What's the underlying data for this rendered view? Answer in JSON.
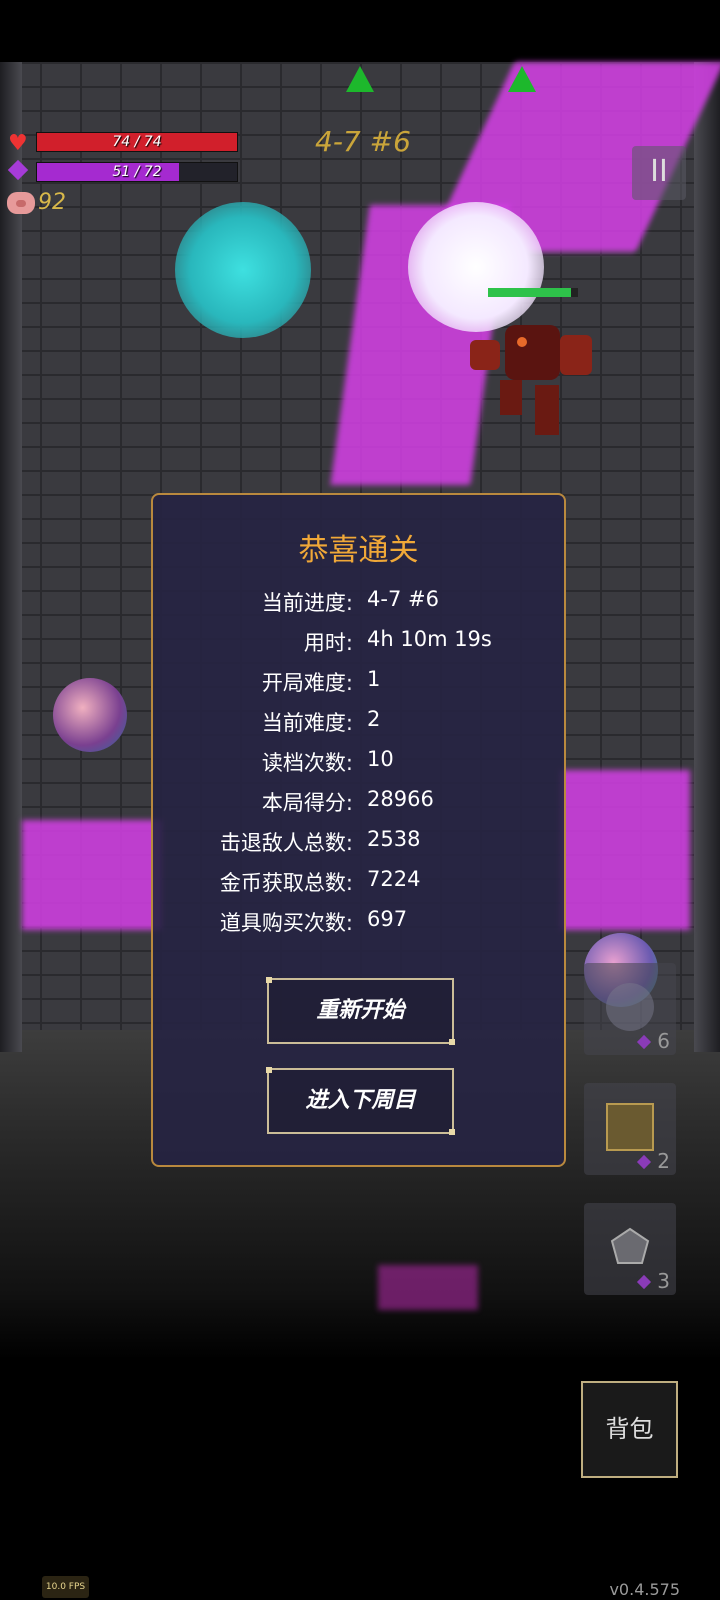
{
  "hud": {
    "hp_text": "74 / 74",
    "hp_fraction": 1.0,
    "mp_text": "51 / 72",
    "mp_fraction": 0.708,
    "coins": "92",
    "stage": "4-7 #6",
    "pause_symbol": "II",
    "colors": {
      "hp": "#d11f2b",
      "mp": "#a52ad0",
      "stage": "#caa53a",
      "coins": "#d8b84a"
    }
  },
  "enemy": {
    "health_fraction": 0.92
  },
  "dialog": {
    "title": "恭喜通关",
    "stats": [
      {
        "label": "当前进度:",
        "value": "4-7 #6"
      },
      {
        "label": "用时:",
        "value": "4h 10m 19s"
      },
      {
        "label": "开局难度:",
        "value": "1"
      },
      {
        "label": "当前难度:",
        "value": "2"
      },
      {
        "label": "读档次数:",
        "value": "10"
      },
      {
        "label": "本局得分:",
        "value": "28966"
      },
      {
        "label": "击退敌人总数:",
        "value": "2538"
      },
      {
        "label": "金币获取总数:",
        "value": "7224"
      },
      {
        "label": "道具购买次数:",
        "value": "697"
      }
    ],
    "restart_label": "重新开始",
    "next_cycle_label": "进入下周目"
  },
  "skills": [
    {
      "icon": "orb-icon",
      "count": "6"
    },
    {
      "icon": "cube-icon",
      "count": "2"
    },
    {
      "icon": "d20-icon",
      "count": "3"
    }
  ],
  "bag_label": "背包",
  "fps": "10.0 FPS",
  "version": "v0.4.575"
}
